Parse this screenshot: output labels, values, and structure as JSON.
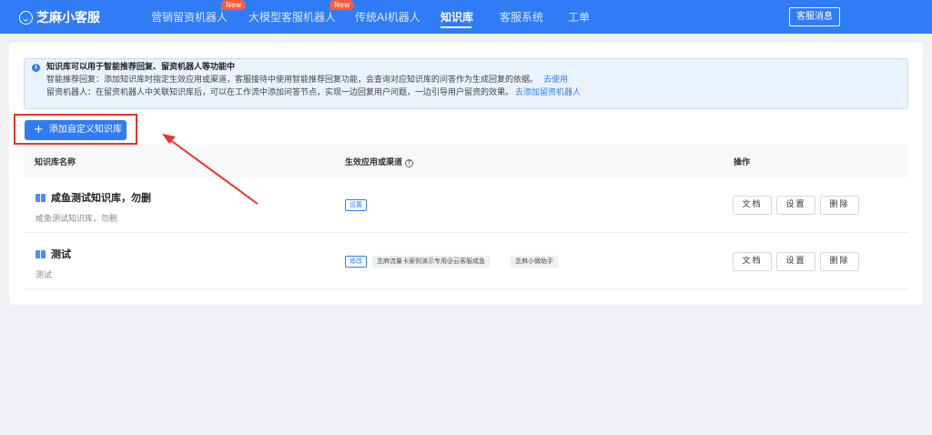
{
  "nav": {
    "logo": "芝麻小客服",
    "items": [
      {
        "label": "营销留资机器人",
        "badge": "New"
      },
      {
        "label": "大模型客服机器人",
        "badge": "New"
      },
      {
        "label": "传统AI机器人",
        "badge": ""
      },
      {
        "label": "知识库",
        "badge": "",
        "active": true
      },
      {
        "label": "客服系统",
        "badge": ""
      },
      {
        "label": "工单",
        "badge": ""
      }
    ],
    "right_button": "客服消息"
  },
  "info": {
    "title": "知识库可以用于智能推荐回复、留资机器人等功能中",
    "line1": "智能推荐回复：添加知识库时指定生效应用或渠道，客服接待中使用智能推荐回复功能，会查询对应知识库的问答作为生成回复的依据。",
    "line1_link": "去使用",
    "line2": "留资机器人：在留资机器人中关联知识库后，可以在工作流中添加问答节点，实现一边回复用户问题，一边引导用户留资的效果。",
    "line2_link": "去添加留资机器人"
  },
  "add_button": "添加自定义知识库",
  "table": {
    "headers": [
      "知识库名称",
      "生效应用或渠道",
      "操作"
    ],
    "rows": [
      {
        "name": "咸鱼测试知识库，勿删",
        "desc": "咸鱼测试知识库，勿删",
        "channel_action": "设置",
        "channels": [],
        "actions": [
          "文档",
          "设置",
          "删除"
        ]
      },
      {
        "name": "测试",
        "desc": "测试",
        "channel_action": "修改",
        "channels": [
          "芝麻流量卡案例演示专用@云客服咸鱼",
          "芝麻小微助手"
        ],
        "actions": [
          "文档",
          "设置",
          "删除"
        ]
      }
    ]
  },
  "colors": {
    "primary": "#2f7cf6",
    "badge": "#ff5a3c",
    "annotation": "#e8332c"
  }
}
